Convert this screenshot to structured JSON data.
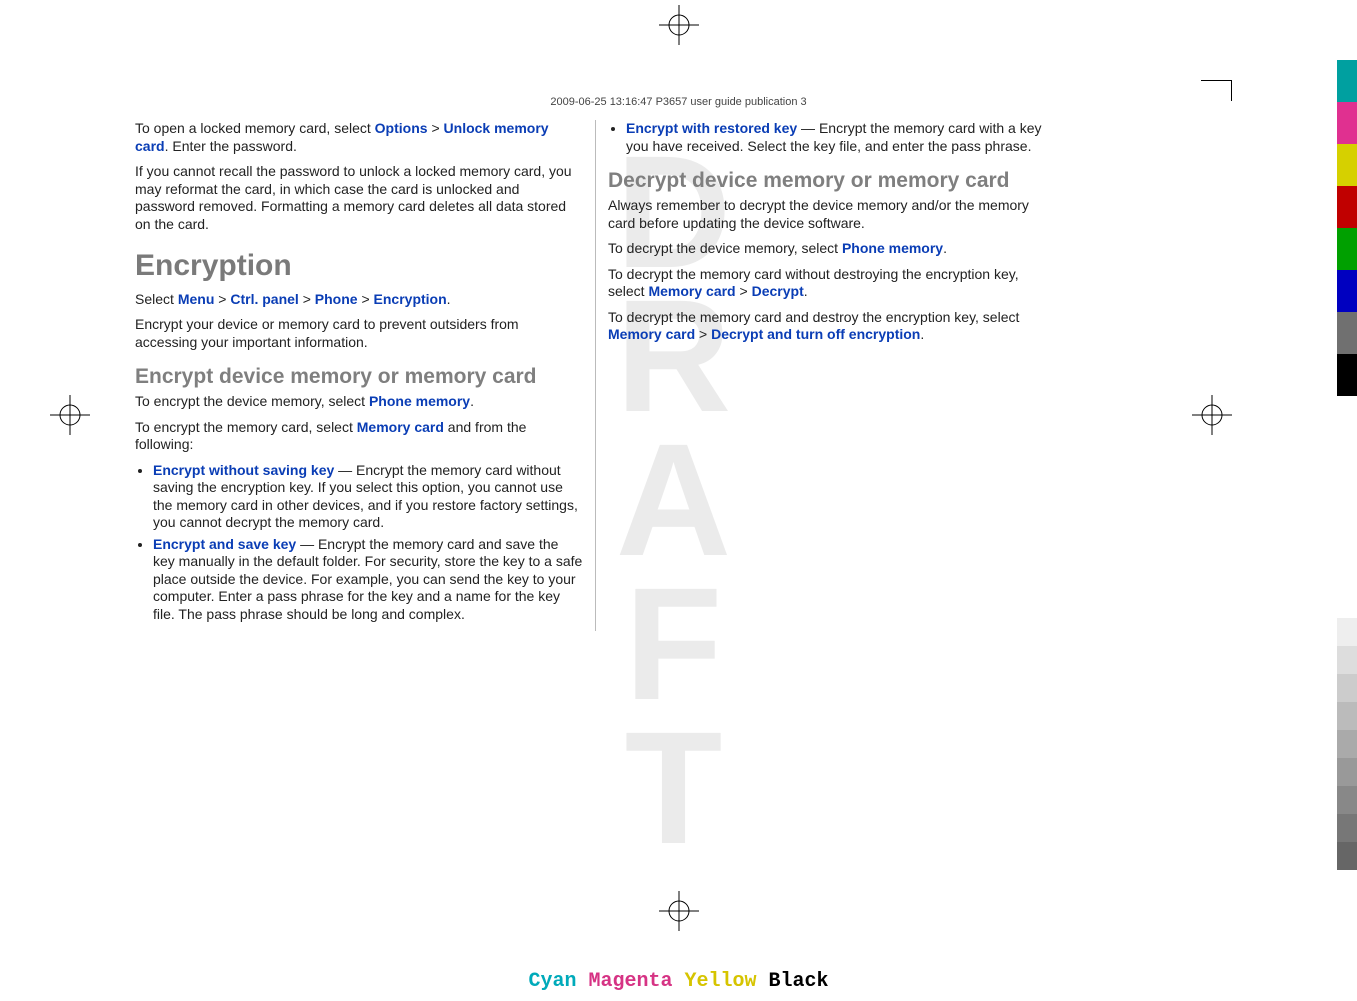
{
  "header": "2009-06-25 13:16:47 P3657 user guide publication 3",
  "draft_letters": [
    "D",
    "R",
    "A",
    "F",
    "T"
  ],
  "left": {
    "p1a": "To open a locked memory card, select ",
    "p1_opt": "Options",
    "p1_gt": " > ",
    "p1_unlock": "Unlock memory card",
    "p1b": ". Enter the password.",
    "p2": "If you cannot recall the password to unlock a locked memory card, you may reformat the card, in which case the card is unlocked and password removed. Formatting a memory card deletes all data stored on the card.",
    "h1": "Encryption",
    "p3a": "Select ",
    "menu": "Menu",
    "ctrl": "Ctrl. panel",
    "phone": "Phone",
    "enc": "Encryption",
    "p3b": ".",
    "p4": "Encrypt your device or memory card to prevent outsiders from accessing your important information.",
    "h2": "Encrypt device memory or memory card",
    "p5a": "To encrypt the device memory, select ",
    "pm": "Phone memory",
    "p5b": ".",
    "p6a": "To encrypt the memory card, select ",
    "mc": "Memory card",
    "p6b": " and from the following:",
    "b1t": "Encrypt without saving key",
    "b1d": " — Encrypt the memory card without saving the encryption key. If you select this option, you cannot use the memory card in other devices, and if you restore factory settings, you cannot decrypt the memory card.",
    "b2t": "Encrypt and save key",
    "b2d": " — Encrypt the memory card and save the key manually in the default folder. For security, store the key to a safe place outside the device. For example, you can send the key to your computer. Enter a pass phrase for the key and a name for the key file. The pass phrase should be long and complex."
  },
  "right": {
    "b3t": "Encrypt with restored key",
    "b3d": " — Encrypt the memory card with a key you have received. Select the key file, and enter the pass phrase.",
    "h2": "Decrypt device memory or memory card",
    "p1": "Always remember to decrypt the device memory and/or the memory card before updating the device software.",
    "p2a": "To decrypt the device memory, select ",
    "pm": "Phone memory",
    "p2b": ".",
    "p3a": "To decrypt the memory card without destroying the encryption key, select ",
    "mc": "Memory card",
    "gt": " > ",
    "dec": "Decrypt",
    "p3b": ".",
    "p4a": "To decrypt the memory card and destroy the encryption key, select ",
    "decoff": "Decrypt and turn off encryption",
    "p4b": "."
  },
  "footer": {
    "cyan": "Cyan",
    "magenta": "Magenta",
    "yellow": "Yellow",
    "black": "Black"
  },
  "color_bars": [
    "#00a0a0",
    "#e03090",
    "#d6d000",
    "#c00000",
    "#00a000",
    "#0000c0",
    "#707070",
    "#000000"
  ],
  "gray_bars": [
    "#fff",
    "#eee",
    "#ddd",
    "#ccc",
    "#bbb",
    "#aaa",
    "#999",
    "#888",
    "#777",
    "#666"
  ]
}
